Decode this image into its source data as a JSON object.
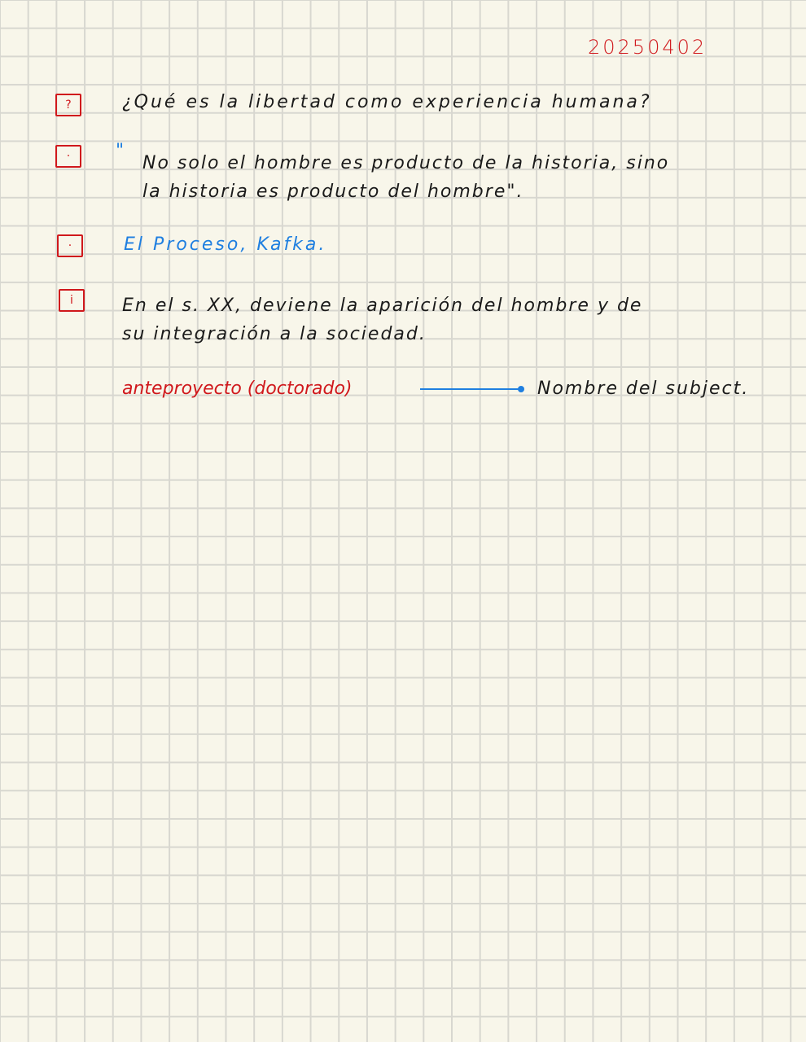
{
  "date": "20250402",
  "entries": [
    {
      "marker": "question-box",
      "marker_glyph": "?",
      "lines": [
        "¿Qué es la libertad como experiencia humana?"
      ]
    },
    {
      "marker": "dot-box",
      "marker_glyph": "·",
      "quote_mark": "\"",
      "lines": [
        "No solo el hombre es producto de la historia, sino",
        "la historia es producto del hombre\"."
      ]
    },
    {
      "marker": "dot-box",
      "marker_glyph": "·",
      "lines": [
        "El Proceso, Kafka."
      ]
    },
    {
      "marker": "info-box",
      "marker_glyph": "i",
      "lines": [
        "En el s. XX, deviene la aparición del hombre y de",
        "su integración a la sociedad."
      ]
    }
  ],
  "mapping": {
    "left": "anteproyecto (doctorado)",
    "right": "Nombre del subject."
  },
  "colors": {
    "red": "#d0181c",
    "blue": "#1f7fe0",
    "ink": "#1a1a1a",
    "paper": "#f8f6ea",
    "grid": "#d8d7d0"
  }
}
